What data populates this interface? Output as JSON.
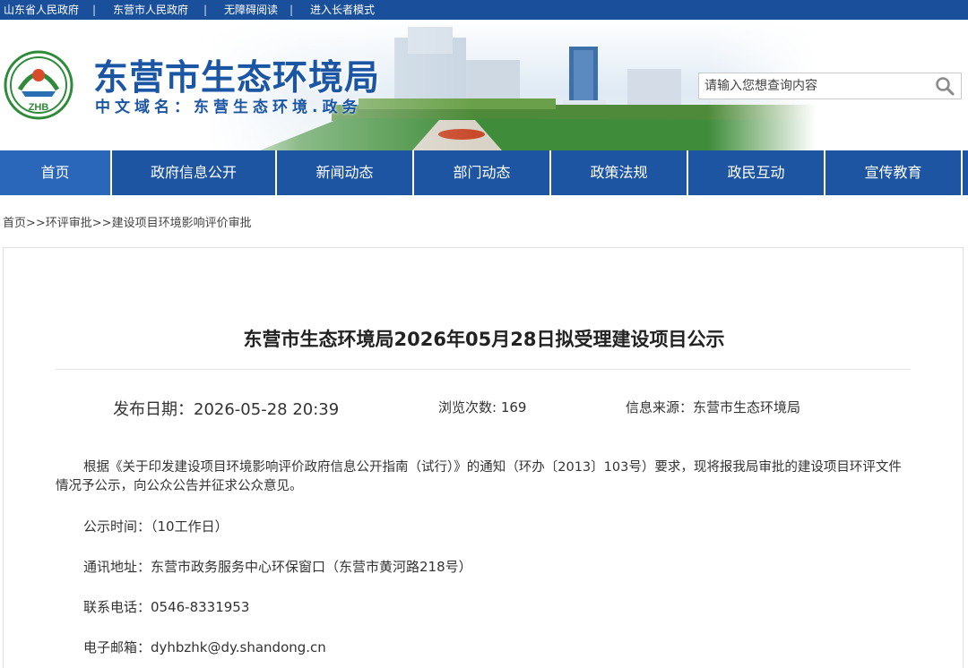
{
  "top_links": [
    "山东省人民政府",
    "东营市人民政府",
    "无障碍阅读",
    "进入长者模式"
  ],
  "separator": "|",
  "header": {
    "title": "东营市生态环境局",
    "domain": "中文域名：东营生态环境.政务",
    "logo_text": "ZHB"
  },
  "search": {
    "placeholder": "请输入您想查询内容"
  },
  "nav": [
    "首页",
    "政府信息公开",
    "新闻动态",
    "部门动态",
    "政策法规",
    "政民互动",
    "宣传教育"
  ],
  "breadcrumb": "首页>>环评审批>>建设项目环境影响评价审批",
  "article": {
    "title": "东营市生态环境局2026年05月28日拟受理建设项目公示",
    "publish_date": "发布日期：2026-05-28 20:39",
    "views": "浏览次数: 169",
    "source": "信息来源：东营市生态环境局",
    "intro": "根据《关于印发建设项目环境影响评价政府信息公开指南（试行）》的通知（环办〔2013〕103号）要求，现将报我局审批的建设项目环评文件情况予公示，向公众公告并征求公众意见。",
    "period": "公示时间：（10工作日）",
    "address": "通讯地址：东营市政务服务中心环保窗口（东营市黄河路218号）",
    "phone": "联系电话：0546-8331953",
    "email": "电子邮箱：dyhbzhk@dy.shandong.cn"
  },
  "colors": {
    "brand_blue": "#1d55a3",
    "top_bar": "#1a4f9c",
    "title_blue": "#1b56a5"
  }
}
